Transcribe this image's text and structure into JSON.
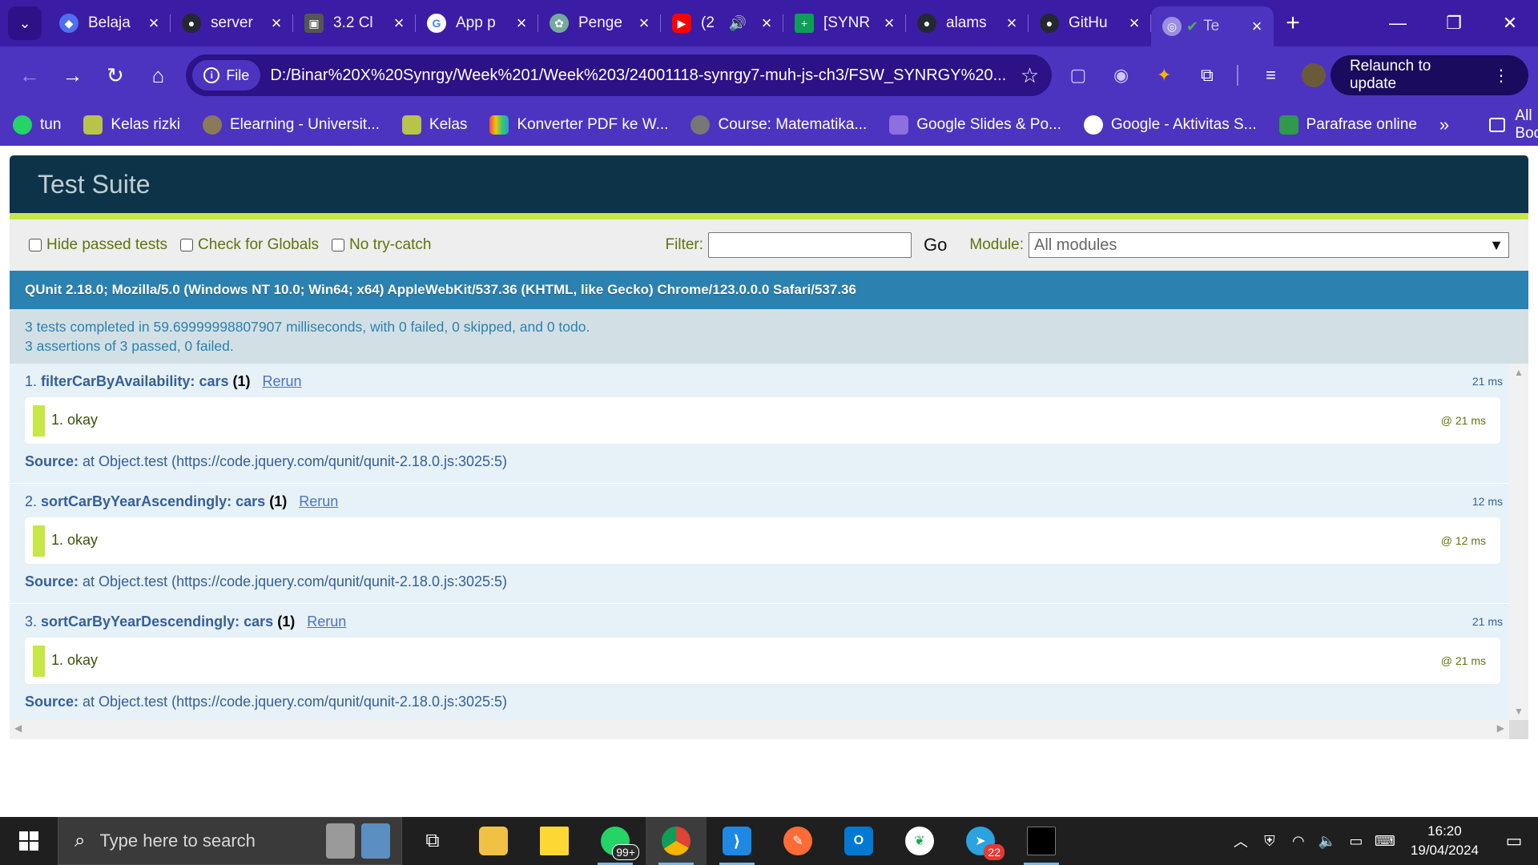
{
  "browser": {
    "tabs": [
      {
        "title": "Belaja",
        "favicon_color": "#4f6ff0"
      },
      {
        "title": "server",
        "favicon_color": "#24292f"
      },
      {
        "title": "3.2 Cl",
        "favicon_color": "#555555"
      },
      {
        "title": "App p",
        "favicon_color": "#ffffff"
      },
      {
        "title": "Penge",
        "favicon_color": "#74aa9c"
      },
      {
        "title": "(2",
        "favicon_color": "#ff0000"
      },
      {
        "title": "[SYNR",
        "favicon_color": "#0f9d58"
      },
      {
        "title": "alams",
        "favicon_color": "#24292f"
      },
      {
        "title": "GitHu",
        "favicon_color": "#24292f"
      },
      {
        "title": "Te",
        "favicon_color": "#9b8fe0"
      }
    ],
    "address": {
      "chip_label": "File",
      "url": "D:/Binar%20X%20Synrgy/Week%201/Week%203/24001118-synrgy7-muh-js-ch3/FSW_SYNRGY%20..."
    },
    "relaunch_label": "Relaunch to update",
    "bookmarks": [
      {
        "label": "tun",
        "color": "#25d366"
      },
      {
        "label": "Kelas rizki",
        "color": "#b8c34a"
      },
      {
        "label": "Elearning - Universit...",
        "color": "#8a7a5a"
      },
      {
        "label": "Kelas",
        "color": "#b8c34a"
      },
      {
        "label": "Konverter PDF ke W...",
        "color": "#e84c3d"
      },
      {
        "label": "Course: Matematika...",
        "color": "#777777"
      },
      {
        "label": "Google Slides & Po...",
        "color": "#8e6fe0"
      },
      {
        "label": "Google - Aktivitas S...",
        "color": "#ffffff"
      },
      {
        "label": "Parafrase online",
        "color": "#2e9a4a"
      }
    ],
    "all_bookmarks_label": "All Bookmarks"
  },
  "qunit": {
    "title": "Test Suite",
    "toolbar": {
      "hide_passed": "Hide passed tests",
      "check_globals": "Check for Globals",
      "no_try_catch": "No try-catch",
      "filter_label": "Filter:",
      "go_label": "Go",
      "module_label": "Module:",
      "module_value": "All modules"
    },
    "user_agent": "QUnit 2.18.0; Mozilla/5.0 (Windows NT 10.0; Win64; x64) AppleWebKit/537.36 (KHTML, like Gecko) Chrome/123.0.0.0 Safari/537.36",
    "result_line1": "3 tests completed in 59.69999998807907 milliseconds, with 0 failed, 0 skipped, and 0 todo.",
    "result_line2": "3 assertions of 3 passed, 0 failed.",
    "tests": [
      {
        "num": "1.",
        "module": "filterCarByAvailability:",
        "name": "cars",
        "count": "(1)",
        "rerun": "Rerun",
        "runtime": "21 ms",
        "assertion": "1. okay",
        "assertion_time": "@ 21 ms",
        "source_label": "Source:",
        "source": "at Object.test (https://code.jquery.com/qunit/qunit-2.18.0.js:3025:5)"
      },
      {
        "num": "2.",
        "module": "sortCarByYearAscendingly:",
        "name": "cars",
        "count": "(1)",
        "rerun": "Rerun",
        "runtime": "12 ms",
        "assertion": "1. okay",
        "assertion_time": "@ 12 ms",
        "source_label": "Source:",
        "source": "at Object.test (https://code.jquery.com/qunit/qunit-2.18.0.js:3025:5)"
      },
      {
        "num": "3.",
        "module": "sortCarByYearDescendingly:",
        "name": "cars",
        "count": "(1)",
        "rerun": "Rerun",
        "runtime": "21 ms",
        "assertion": "1. okay",
        "assertion_time": "@ 21 ms",
        "source_label": "Source:",
        "source": "at Object.test (https://code.jquery.com/qunit/qunit-2.18.0.js:3025:5)"
      }
    ]
  },
  "taskbar": {
    "search_placeholder": "Type here to search",
    "whatsapp_badge": "99+",
    "telegram_badge": "22",
    "time": "16:20",
    "date": "19/04/2024"
  }
}
